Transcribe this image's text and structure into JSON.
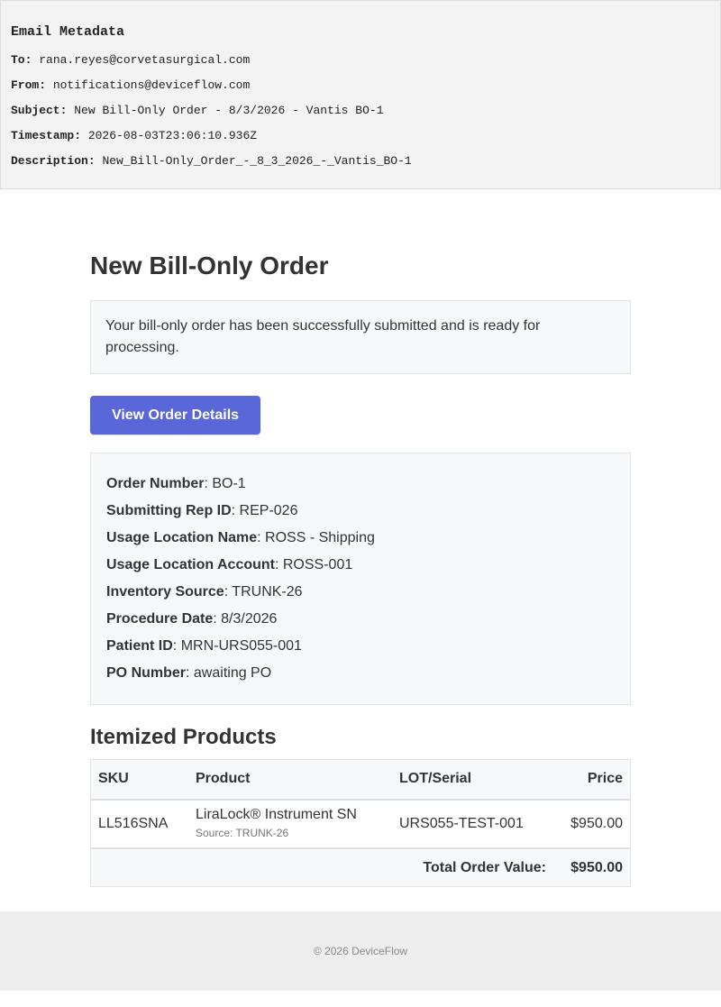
{
  "metadata": {
    "title": "Email Metadata",
    "to_label": "To:",
    "to": "rana.reyes@corvetasurgical.com",
    "from_label": "From:",
    "from": "notifications@deviceflow.com",
    "subject_label": "Subject:",
    "subject": "New Bill-Only Order - 8/3/2026 - Vantis BO-1",
    "timestamp_label": "Timestamp:",
    "timestamp": "2026-08-03T23:06:10.936Z",
    "description_label": "Description:",
    "description": "New_Bill-Only_Order_-_8_3_2026_-_Vantis_BO-1"
  },
  "email": {
    "heading": "New Bill-Only Order",
    "notice": "Your bill-only order has been successfully submitted and is ready for processing.",
    "button_label": "View Order Details",
    "button_color": "#5a67d8",
    "details": [
      {
        "label": "Order Number",
        "value": ": BO-1"
      },
      {
        "label": "Submitting Rep ID",
        "value": ": REP-026"
      },
      {
        "label": "Usage Location Name",
        "value": ": ROSS - Shipping"
      },
      {
        "label": "Usage Location Account",
        "value": ": ROSS-001"
      },
      {
        "label": "Inventory Source",
        "value": ": TRUNK-26"
      },
      {
        "label": "Procedure Date",
        "value": ": 8/3/2026"
      },
      {
        "label": "Patient ID",
        "value": ": MRN-URS055-001"
      },
      {
        "label": "PO Number",
        "value": ": awaiting PO"
      }
    ],
    "products_title": "Itemized Products",
    "table": {
      "headers": {
        "sku": "SKU",
        "product": "Product",
        "lot": "LOT/Serial",
        "price": "Price"
      },
      "rows": [
        {
          "sku": "LL516SNA",
          "product": "LiraLock® Instrument SN",
          "source": "Source: TRUNK-26",
          "lot": "URS055-TEST-001",
          "price": "$950.00"
        }
      ],
      "total_label": "Total Order Value:",
      "total_value": "$950.00"
    }
  },
  "footer": {
    "copyright": "© 2026 DeviceFlow"
  }
}
